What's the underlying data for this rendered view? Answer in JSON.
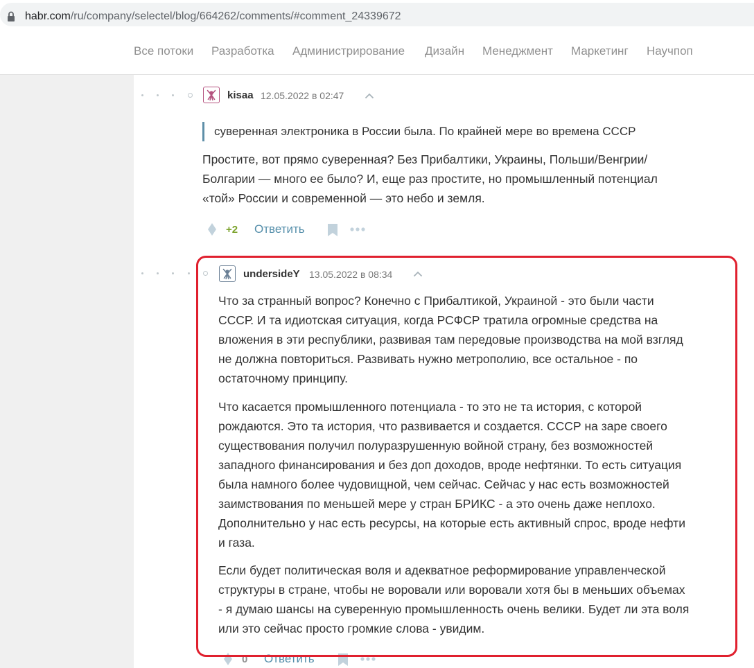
{
  "browser": {
    "url_host": "habr.com",
    "url_path": "/ru/company/selectel/blog/664262/comments/#comment_24339672"
  },
  "nav": {
    "items": [
      "Все потоки",
      "Разработка",
      "Администрирование",
      "Дизайн",
      "Менеджмент",
      "Маркетинг",
      "Научпоп"
    ]
  },
  "comments": [
    {
      "username": "kisaa",
      "timestamp": "12.05.2022 в 02:47",
      "avatar_color": "#b5537f",
      "quote": "суверенная электроника в России была. По крайней мере во времена СССР",
      "lines": [
        "Простите, вот прямо суверенная? Без Прибалтики, Украины, Польши/Венгрии/",
        "Болгарии — много ее было? И, еще раз простите, но промышленный потенциал",
        "«той» России и современной — это небо и земля."
      ],
      "score": "+2",
      "reply_label": "Ответить"
    },
    {
      "username": "undersideY",
      "timestamp": "13.05.2022 в 08:34",
      "avatar_color": "#6a7f95",
      "paragraphs": [
        [
          "Что за странный вопрос? Конечно с Прибалтикой, Украиной - это были части",
          "СССР. И та идиотская ситуация, когда РСФСР тратила огромные средства на",
          "вложения в эти республики, развивая там передовые производства на мой взгляд",
          "не должна повториться. Развивать нужно метрополию, все остальное - по",
          "остаточному принципу."
        ],
        [
          "Что касается промышленного потенциала - то это не та история, с которой",
          "рождаются. Это та история, что развивается и создается. СССР на заре своего",
          "существования получил полуразрушенную войной страну, без возможностей",
          "западного финансирования и без доп доходов, вроде нефтянки. То есть ситуация",
          "была намного более чудовищной, чем сейчас. Сейчас у нас есть возможностей",
          "заимствования по меньшей мере у стран БРИКС - а это очень даже неплохо.",
          "Дополнительно у нас есть ресурсы, на которые есть активный спрос, вроде нефти",
          "и газа."
        ],
        [
          "Если будет политическая воля и адекватное реформирование управленческой",
          "структуры в стране, чтобы не воровали или воровали хотя бы в меньших объемах",
          "- я думаю шансы на суверенную промышленность очень велики. Будет ли эта воля",
          "или это сейчас просто громкие слова - увидим."
        ]
      ],
      "score": "0",
      "reply_label": "Ответить"
    }
  ],
  "colors": {
    "highlight": "#e0202e",
    "reply_link": "#548eaa",
    "positive_score": "#7ba22b",
    "quote_bar": "#5e8fa8"
  },
  "icons": [
    "lock-icon",
    "avatar-icon",
    "collapse-chevron-icon",
    "vote-icon",
    "bookmark-icon",
    "more-icon"
  ]
}
